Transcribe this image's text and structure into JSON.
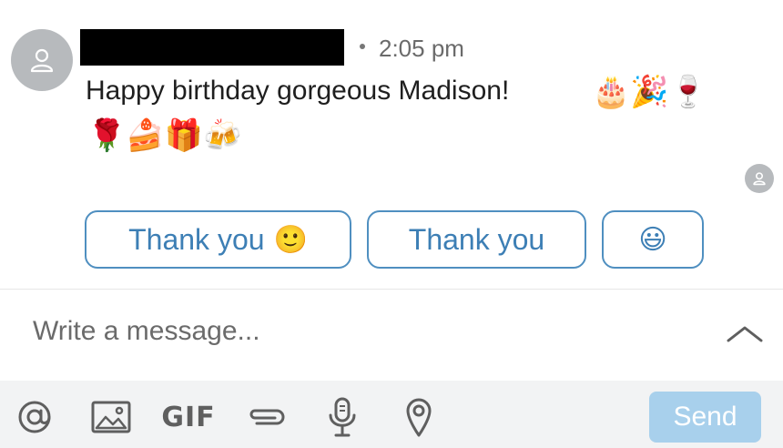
{
  "message": {
    "time": "2:05 pm",
    "text": "Happy birthday gorgeous Madison!",
    "emojis_line1": "🎂🎉🍷",
    "emojis_line2": "🌹🍰🎁🍻"
  },
  "smart_replies": [
    {
      "label": "Thank you",
      "emoji": "🙂"
    },
    {
      "label": "Thank you",
      "emoji": ""
    },
    {
      "label": "",
      "emoji": "😃"
    }
  ],
  "composer": {
    "placeholder": "Write a message..."
  },
  "toolbar": {
    "icons": [
      "at-icon",
      "image-icon",
      "gif-icon",
      "attachment-icon",
      "microphone-icon",
      "location-icon"
    ],
    "gif_label": "GIF",
    "send_label": "Send"
  },
  "colors": {
    "accent": "#3d7fb5",
    "send_disabled": "#a8d0ec",
    "toolbar_bg": "#f2f3f4"
  }
}
